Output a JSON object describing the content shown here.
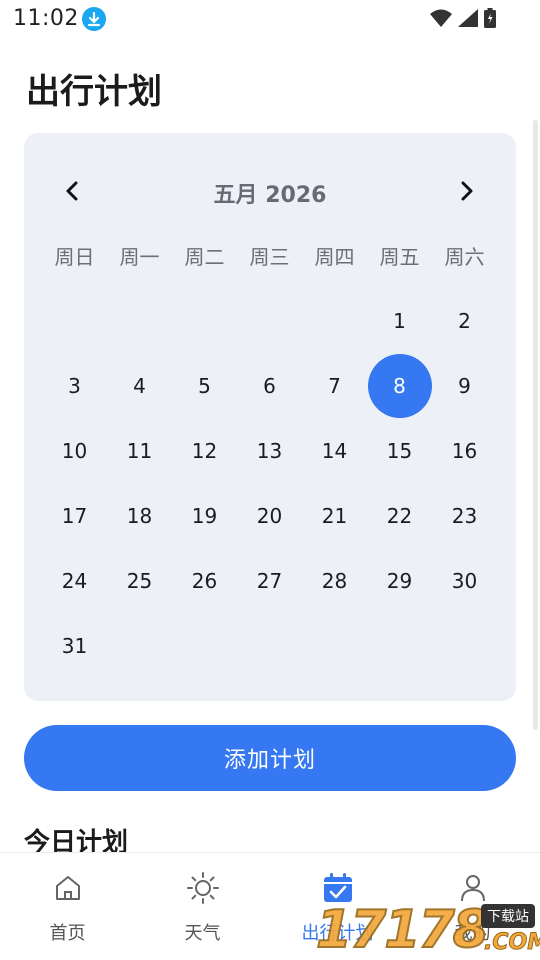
{
  "status_bar": {
    "time": "11:02"
  },
  "page_title": "出行计划",
  "calendar": {
    "month_label": "五月 2026",
    "weekdays": [
      "周日",
      "周一",
      "周二",
      "周三",
      "周四",
      "周五",
      "周六"
    ],
    "leading_blanks": 5,
    "days_in_month": 31,
    "selected_day": 8
  },
  "add_button_label": "添加计划",
  "today_section_title": "今日计划",
  "bottom_nav": [
    {
      "label": "首页",
      "icon": "home-icon"
    },
    {
      "label": "天气",
      "icon": "sun-icon"
    },
    {
      "label": "出行计划",
      "icon": "calendar-check-icon"
    },
    {
      "label": "我的",
      "icon": "person-icon"
    }
  ],
  "active_tab": 2,
  "watermark": {
    "number": "17178",
    "badge": "下载站",
    "suffix": ".COM"
  },
  "colors": {
    "accent": "#3578f1",
    "card_bg": "#edf0f7",
    "download_badge": "#1aa6f0"
  }
}
